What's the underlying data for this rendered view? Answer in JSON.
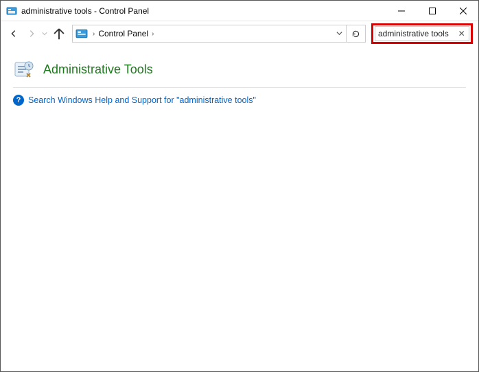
{
  "window": {
    "title": "administrative tools - Control Panel"
  },
  "nav": {
    "breadcrumb_root": "Control Panel"
  },
  "search": {
    "value": "administrative tools"
  },
  "results": {
    "heading": "Administrative Tools",
    "help_link": "Search Windows Help and Support for \"administrative tools\""
  }
}
